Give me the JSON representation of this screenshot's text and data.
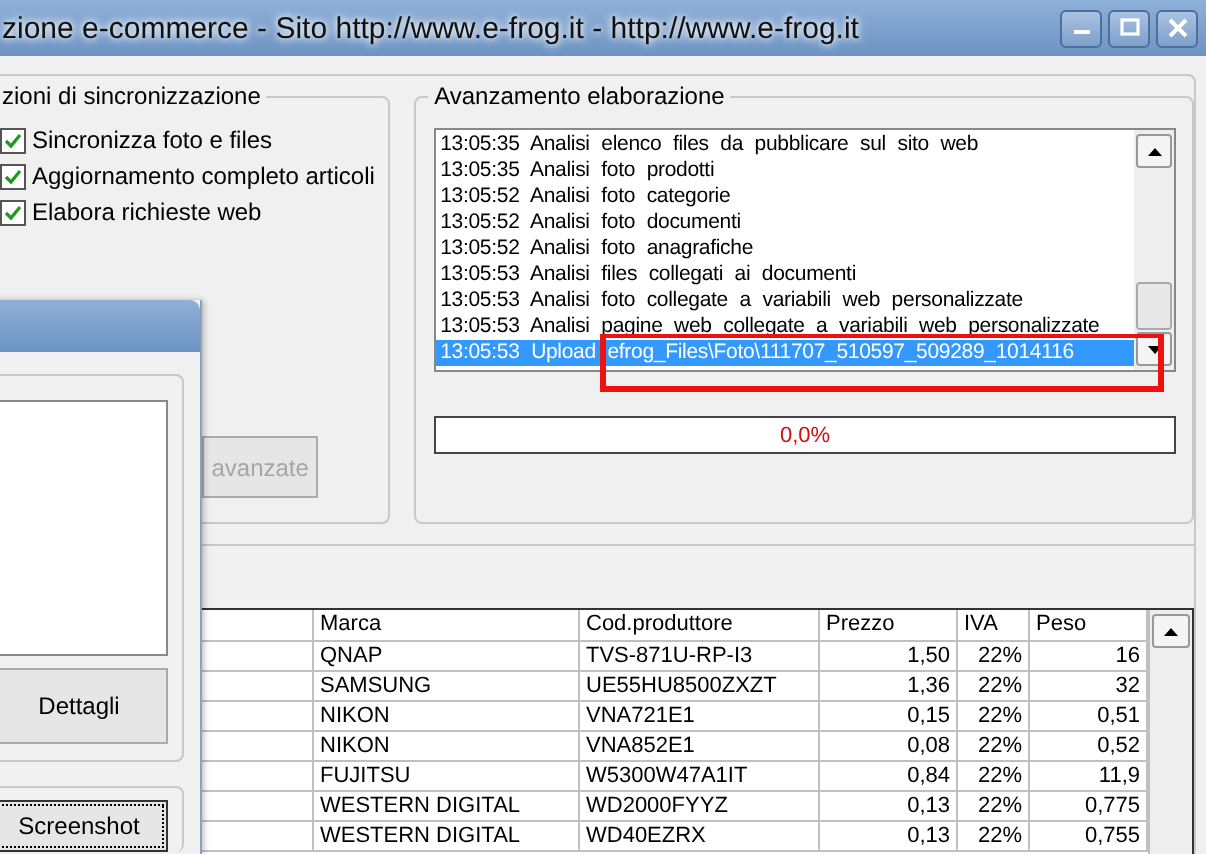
{
  "window": {
    "title": "zione e-commerce - Sito http://www.e-frog.it - http://www.e-frog.it"
  },
  "sync_options": {
    "title": "zioni di sincronizzazione",
    "options": [
      {
        "label": "Sincronizza foto e files",
        "checked": true
      },
      {
        "label": "Aggiornamento completo articoli",
        "checked": true
      },
      {
        "label": "Elabora richieste web",
        "checked": true
      }
    ],
    "advanced_button": {
      "label": "avanzate",
      "disabled": true
    }
  },
  "progress": {
    "title": "Avanzamento elaborazione",
    "log": [
      {
        "time": "13:05:35",
        "text": "Analisi elenco files da pubblicare sul sito web",
        "selected": false
      },
      {
        "time": "13:05:35",
        "text": "Analisi foto prodotti",
        "selected": false
      },
      {
        "time": "13:05:52",
        "text": "Analisi foto categorie",
        "selected": false
      },
      {
        "time": "13:05:52",
        "text": "Analisi foto documenti",
        "selected": false
      },
      {
        "time": "13:05:52",
        "text": "Analisi foto anagrafiche",
        "selected": false
      },
      {
        "time": "13:05:53",
        "text": "Analisi files collegati ai documenti",
        "selected": false
      },
      {
        "time": "13:05:53",
        "text": "Analisi foto collegate a variabili web personalizzate",
        "selected": false
      },
      {
        "time": "13:05:53",
        "text": "Analisi pagine web collegate a variabili web personalizzate",
        "selected": false
      },
      {
        "time": "13:05:53",
        "text": "Upload efrog_Files\\Foto\\111707_510597_509289_1014116",
        "selected": true
      }
    ],
    "level": 0,
    "reading": "0,0%"
  },
  "front_window": {
    "buttons": [
      {
        "label": "Dettagli",
        "focused": false
      },
      {
        "label": "Screenshot",
        "focused": true
      }
    ]
  },
  "table": {
    "columns": [
      "Marca",
      "Cod.produttore",
      "Prezzo",
      "IVA",
      "Peso"
    ],
    "rows": [
      [
        "QNAP",
        "TVS-871U-RP-I3",
        "1,50",
        "22%",
        "16"
      ],
      [
        "SAMSUNG",
        "UE55HU8500ZXZT",
        "1,36",
        "22%",
        "32"
      ],
      [
        "NIKON",
        "VNA721E1",
        "0,15",
        "22%",
        "0,51"
      ],
      [
        "NIKON",
        "VNA852E1",
        "0,08",
        "22%",
        "0,52"
      ],
      [
        "FUJITSU",
        "W5300W47A1IT",
        "0,84",
        "22%",
        "11,9"
      ],
      [
        "WESTERN DIGITAL",
        "WD2000FYYZ",
        "0,13",
        "22%",
        "0,775"
      ],
      [
        "WESTERN DIGITAL",
        "WD40EZRX",
        "0,13",
        "22%",
        "0,755"
      ]
    ]
  }
}
